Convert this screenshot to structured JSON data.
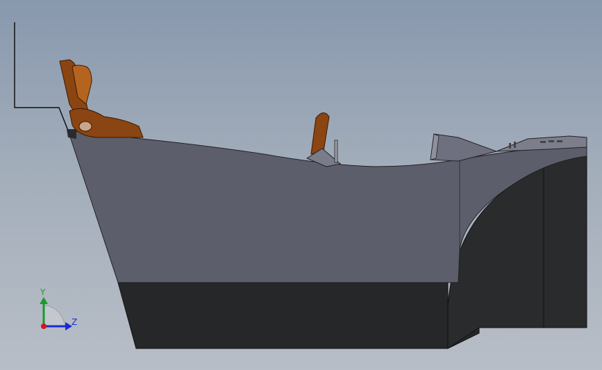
{
  "triad": {
    "y_label": "Y",
    "z_label": "Z",
    "y_color": "#1a9a2a",
    "z_color": "#1a2ad6",
    "x_color": "#d01a1a"
  },
  "colors": {
    "hull_upper": "#5c5e6c",
    "hull_lower": "#262728",
    "seat_wood": "#8a4512",
    "console": "#6e7080",
    "background_top": "#8898ad",
    "background_bottom": "#b8bec7"
  },
  "icons": [
    "triad-axis-icon",
    "seat-icon",
    "lever-icon"
  ]
}
